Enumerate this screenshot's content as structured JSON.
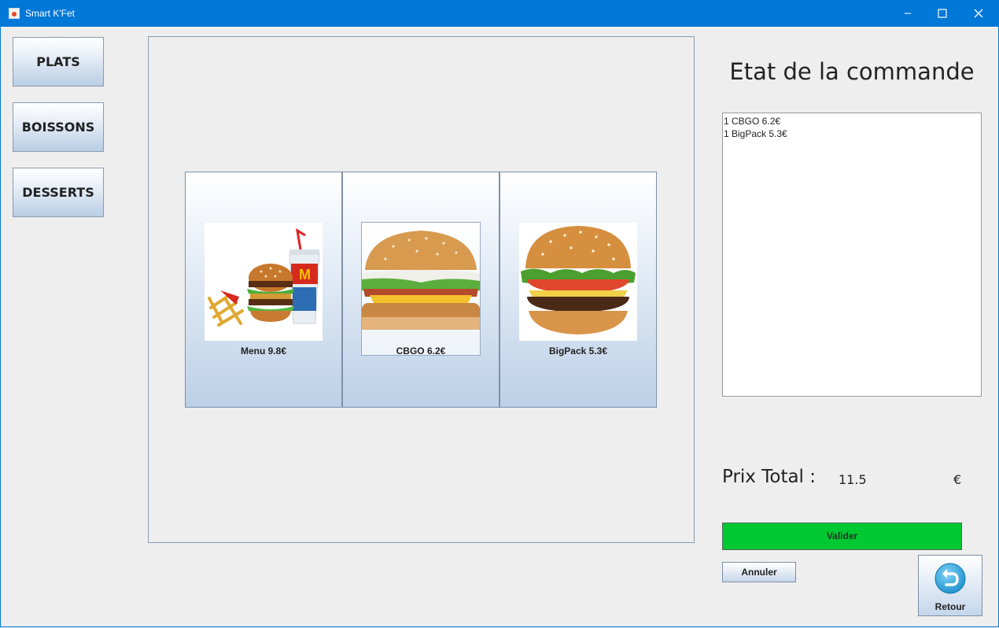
{
  "window": {
    "title": "Smart K'Fet",
    "icons": [
      "app-icon",
      "minimize-icon",
      "maximize-icon",
      "close-icon"
    ]
  },
  "categories": [
    {
      "label": "PLATS"
    },
    {
      "label": "BOISSONS"
    },
    {
      "label": "DESSERTS"
    }
  ],
  "products": [
    {
      "name": "Menu",
      "price": "9.8€",
      "label": "Menu  9.8€"
    },
    {
      "name": "CBGO",
      "price": "6.2€",
      "label": "CBGO  6.2€"
    },
    {
      "name": "BigPack",
      "price": "5.3€",
      "label": "BigPack  5.3€"
    }
  ],
  "order": {
    "title": "Etat de la commande",
    "lines": [
      "1 CBGO 6.2€",
      "1 BigPack 5.3€"
    ],
    "total_label": "Prix Total :",
    "total_value": "11.5",
    "currency": "€"
  },
  "actions": {
    "valider": "Valider",
    "annuler": "Annuler",
    "retour": "Retour"
  },
  "colors": {
    "titlebar": "#0078d7",
    "valider_bg": "#00c832",
    "button_gradient_bottom": "#b9cde4"
  }
}
